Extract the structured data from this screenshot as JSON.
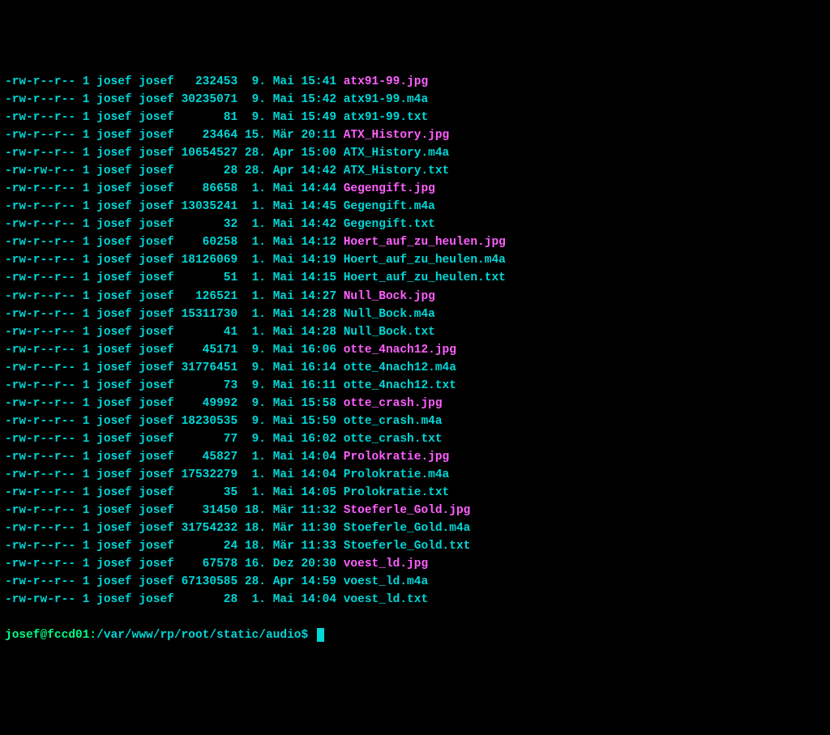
{
  "listing": [
    {
      "perms": "-rw-r--r--",
      "links": "1",
      "owner": "josef",
      "group": "josef",
      "size": "232453",
      "day": " 9.",
      "month": "Mai",
      "time": "15:41",
      "name": "atx91-99.jpg",
      "color": "magenta"
    },
    {
      "perms": "-rw-r--r--",
      "links": "1",
      "owner": "josef",
      "group": "josef",
      "size": "30235071",
      "day": " 9.",
      "month": "Mai",
      "time": "15:42",
      "name": "atx91-99.m4a",
      "color": "cyan"
    },
    {
      "perms": "-rw-r--r--",
      "links": "1",
      "owner": "josef",
      "group": "josef",
      "size": "81",
      "day": " 9.",
      "month": "Mai",
      "time": "15:49",
      "name": "atx91-99.txt",
      "color": "cyan"
    },
    {
      "perms": "-rw-r--r--",
      "links": "1",
      "owner": "josef",
      "group": "josef",
      "size": "23464",
      "day": "15.",
      "month": "Mär",
      "time": "20:11",
      "name": "ATX_History.jpg",
      "color": "magenta"
    },
    {
      "perms": "-rw-r--r--",
      "links": "1",
      "owner": "josef",
      "group": "josef",
      "size": "10654527",
      "day": "28.",
      "month": "Apr",
      "time": "15:00",
      "name": "ATX_History.m4a",
      "color": "cyan"
    },
    {
      "perms": "-rw-rw-r--",
      "links": "1",
      "owner": "josef",
      "group": "josef",
      "size": "28",
      "day": "28.",
      "month": "Apr",
      "time": "14:42",
      "name": "ATX_History.txt",
      "color": "cyan"
    },
    {
      "perms": "-rw-r--r--",
      "links": "1",
      "owner": "josef",
      "group": "josef",
      "size": "86658",
      "day": " 1.",
      "month": "Mai",
      "time": "14:44",
      "name": "Gegengift.jpg",
      "color": "magenta"
    },
    {
      "perms": "-rw-r--r--",
      "links": "1",
      "owner": "josef",
      "group": "josef",
      "size": "13035241",
      "day": " 1.",
      "month": "Mai",
      "time": "14:45",
      "name": "Gegengift.m4a",
      "color": "cyan"
    },
    {
      "perms": "-rw-r--r--",
      "links": "1",
      "owner": "josef",
      "group": "josef",
      "size": "32",
      "day": " 1.",
      "month": "Mai",
      "time": "14:42",
      "name": "Gegengift.txt",
      "color": "cyan"
    },
    {
      "perms": "-rw-r--r--",
      "links": "1",
      "owner": "josef",
      "group": "josef",
      "size": "60258",
      "day": " 1.",
      "month": "Mai",
      "time": "14:12",
      "name": "Hoert_auf_zu_heulen.jpg",
      "color": "magenta"
    },
    {
      "perms": "-rw-r--r--",
      "links": "1",
      "owner": "josef",
      "group": "josef",
      "size": "18126069",
      "day": " 1.",
      "month": "Mai",
      "time": "14:19",
      "name": "Hoert_auf_zu_heulen.m4a",
      "color": "cyan"
    },
    {
      "perms": "-rw-r--r--",
      "links": "1",
      "owner": "josef",
      "group": "josef",
      "size": "51",
      "day": " 1.",
      "month": "Mai",
      "time": "14:15",
      "name": "Hoert_auf_zu_heulen.txt",
      "color": "cyan"
    },
    {
      "perms": "-rw-r--r--",
      "links": "1",
      "owner": "josef",
      "group": "josef",
      "size": "126521",
      "day": " 1.",
      "month": "Mai",
      "time": "14:27",
      "name": "Null_Bock.jpg",
      "color": "magenta"
    },
    {
      "perms": "-rw-r--r--",
      "links": "1",
      "owner": "josef",
      "group": "josef",
      "size": "15311730",
      "day": " 1.",
      "month": "Mai",
      "time": "14:28",
      "name": "Null_Bock.m4a",
      "color": "cyan"
    },
    {
      "perms": "-rw-r--r--",
      "links": "1",
      "owner": "josef",
      "group": "josef",
      "size": "41",
      "day": " 1.",
      "month": "Mai",
      "time": "14:28",
      "name": "Null_Bock.txt",
      "color": "cyan"
    },
    {
      "perms": "-rw-r--r--",
      "links": "1",
      "owner": "josef",
      "group": "josef",
      "size": "45171",
      "day": " 9.",
      "month": "Mai",
      "time": "16:06",
      "name": "otte_4nach12.jpg",
      "color": "magenta"
    },
    {
      "perms": "-rw-r--r--",
      "links": "1",
      "owner": "josef",
      "group": "josef",
      "size": "31776451",
      "day": " 9.",
      "month": "Mai",
      "time": "16:14",
      "name": "otte_4nach12.m4a",
      "color": "cyan"
    },
    {
      "perms": "-rw-r--r--",
      "links": "1",
      "owner": "josef",
      "group": "josef",
      "size": "73",
      "day": " 9.",
      "month": "Mai",
      "time": "16:11",
      "name": "otte_4nach12.txt",
      "color": "cyan"
    },
    {
      "perms": "-rw-r--r--",
      "links": "1",
      "owner": "josef",
      "group": "josef",
      "size": "49992",
      "day": " 9.",
      "month": "Mai",
      "time": "15:58",
      "name": "otte_crash.jpg",
      "color": "magenta"
    },
    {
      "perms": "-rw-r--r--",
      "links": "1",
      "owner": "josef",
      "group": "josef",
      "size": "18230535",
      "day": " 9.",
      "month": "Mai",
      "time": "15:59",
      "name": "otte_crash.m4a",
      "color": "cyan"
    },
    {
      "perms": "-rw-r--r--",
      "links": "1",
      "owner": "josef",
      "group": "josef",
      "size": "77",
      "day": " 9.",
      "month": "Mai",
      "time": "16:02",
      "name": "otte_crash.txt",
      "color": "cyan"
    },
    {
      "perms": "-rw-r--r--",
      "links": "1",
      "owner": "josef",
      "group": "josef",
      "size": "45827",
      "day": " 1.",
      "month": "Mai",
      "time": "14:04",
      "name": "Prolokratie.jpg",
      "color": "magenta"
    },
    {
      "perms": "-rw-r--r--",
      "links": "1",
      "owner": "josef",
      "group": "josef",
      "size": "17532279",
      "day": " 1.",
      "month": "Mai",
      "time": "14:04",
      "name": "Prolokratie.m4a",
      "color": "cyan"
    },
    {
      "perms": "-rw-r--r--",
      "links": "1",
      "owner": "josef",
      "group": "josef",
      "size": "35",
      "day": " 1.",
      "month": "Mai",
      "time": "14:05",
      "name": "Prolokratie.txt",
      "color": "cyan"
    },
    {
      "perms": "-rw-r--r--",
      "links": "1",
      "owner": "josef",
      "group": "josef",
      "size": "31450",
      "day": "18.",
      "month": "Mär",
      "time": "11:32",
      "name": "Stoeferle_Gold.jpg",
      "color": "magenta"
    },
    {
      "perms": "-rw-r--r--",
      "links": "1",
      "owner": "josef",
      "group": "josef",
      "size": "31754232",
      "day": "18.",
      "month": "Mär",
      "time": "11:30",
      "name": "Stoeferle_Gold.m4a",
      "color": "cyan"
    },
    {
      "perms": "-rw-r--r--",
      "links": "1",
      "owner": "josef",
      "group": "josef",
      "size": "24",
      "day": "18.",
      "month": "Mär",
      "time": "11:33",
      "name": "Stoeferle_Gold.txt",
      "color": "cyan"
    },
    {
      "perms": "-rw-r--r--",
      "links": "1",
      "owner": "josef",
      "group": "josef",
      "size": "67578",
      "day": "16.",
      "month": "Dez",
      "time": "20:30",
      "name": "voest_ld.jpg",
      "color": "magenta"
    },
    {
      "perms": "-rw-r--r--",
      "links": "1",
      "owner": "josef",
      "group": "josef",
      "size": "67130585",
      "day": "28.",
      "month": "Apr",
      "time": "14:59",
      "name": "voest_ld.m4a",
      "color": "cyan"
    },
    {
      "perms": "-rw-rw-r--",
      "links": "1",
      "owner": "josef",
      "group": "josef",
      "size": "28",
      "day": " 1.",
      "month": "Mai",
      "time": "14:04",
      "name": "voest_ld.txt",
      "color": "cyan"
    }
  ],
  "prompt": {
    "user_host": "josef@fccd01",
    "separator": ":",
    "path": "/var/www/rp/root/static/audio",
    "sigil": "$"
  }
}
